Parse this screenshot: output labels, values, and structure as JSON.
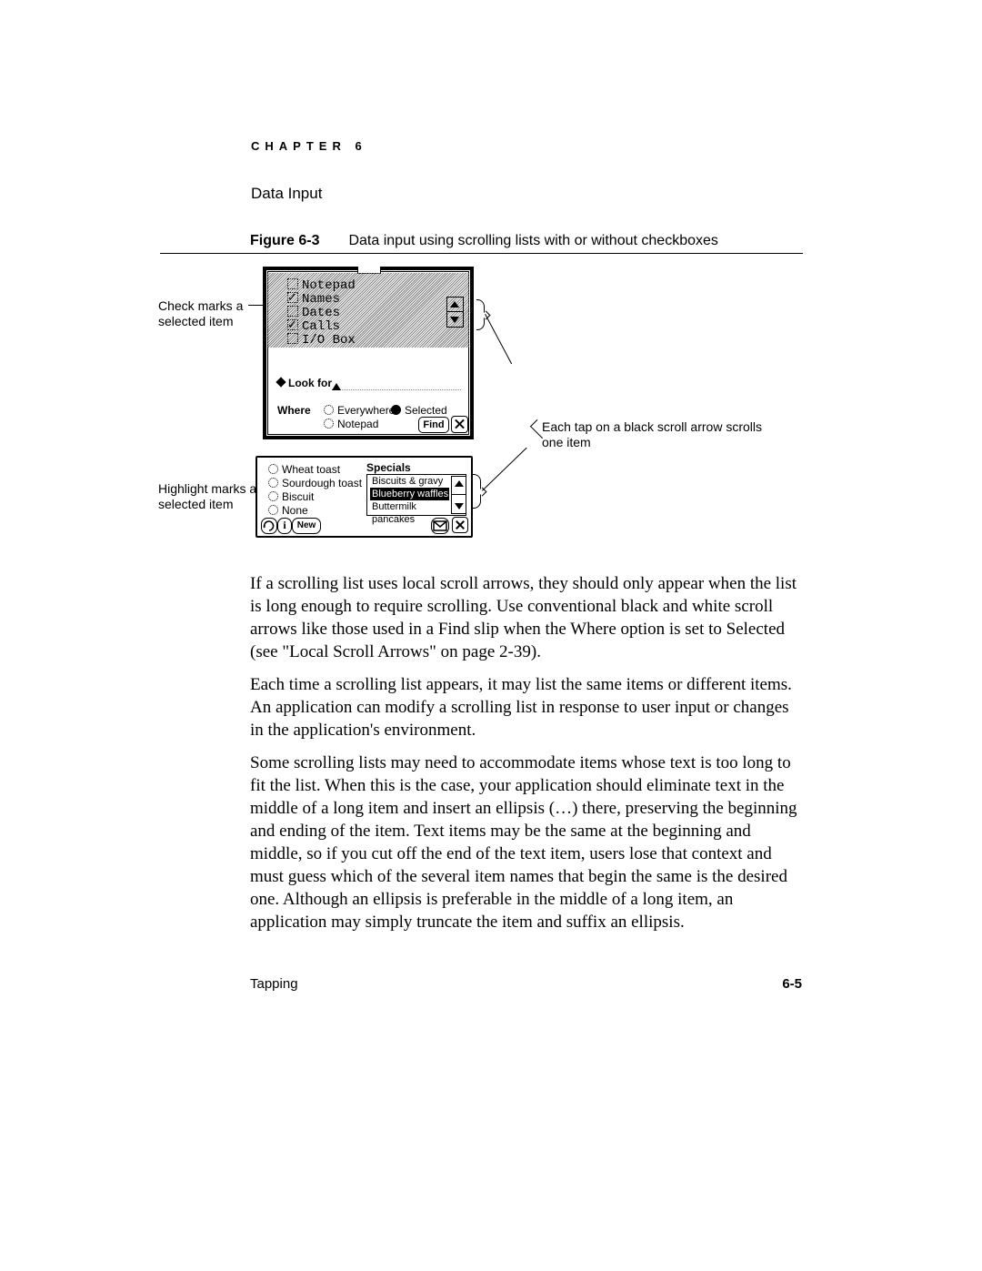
{
  "chapter": "CHAPTER 6",
  "section": "Data Input",
  "figure": {
    "number": "Figure 6-3",
    "caption": "Data input using scrolling lists with or without checkboxes"
  },
  "callouts": {
    "checkmarks": "Check marks a selected item",
    "highlight": "Highlight marks a selected item",
    "scrollhint": "Each tap on a black scroll arrow scrolls one item"
  },
  "findSlip": {
    "items": {
      "notepad": "Notepad",
      "names": "Names",
      "dates": "Dates",
      "calls": "Calls",
      "iobox": "I/O Box"
    },
    "lookfor_label": "Look for",
    "where_label": "Where",
    "opt_everywhere": "Everywhere",
    "opt_selected": "Selected",
    "opt_notepad": "Notepad",
    "find_btn": "Find"
  },
  "listPanel": {
    "toast1": "Wheat toast",
    "toast2": "Sourdough toast",
    "toast3": "Biscuit",
    "toast4": "None",
    "specials_title": "Specials",
    "sp1": "Biscuits & gravy",
    "sp2": "Blueberry waffles",
    "sp3": "Buttermilk pancakes",
    "new_btn": "New"
  },
  "body": {
    "p1": "If a scrolling list uses local scroll arrows, they should only appear when the list is long enough to require scrolling. Use conventional black and white scroll arrows like those used in a Find slip when the Where option is set to Selected (see \"Local Scroll Arrows\" on page 2-39).",
    "p2": "Each time a scrolling list appears, it may list the same items or different items. An application can modify a scrolling list in response to user input or changes in the application's environment.",
    "p3": "Some scrolling lists may need to accommodate items whose text is too long to fit the list. When this is the case, your application should eliminate text in the middle of a long item and insert an ellipsis (…) there, preserving the beginning and ending of the item. Text items may be the same at the beginning and middle, so if you cut off the end of the text item, users lose that context and must guess which of the several item names that begin the same is the desired one. Although an ellipsis is preferable in the middle of a long item, an application may simply truncate the item and suffix an ellipsis."
  },
  "footer": {
    "left": "Tapping",
    "right": "6-5"
  }
}
